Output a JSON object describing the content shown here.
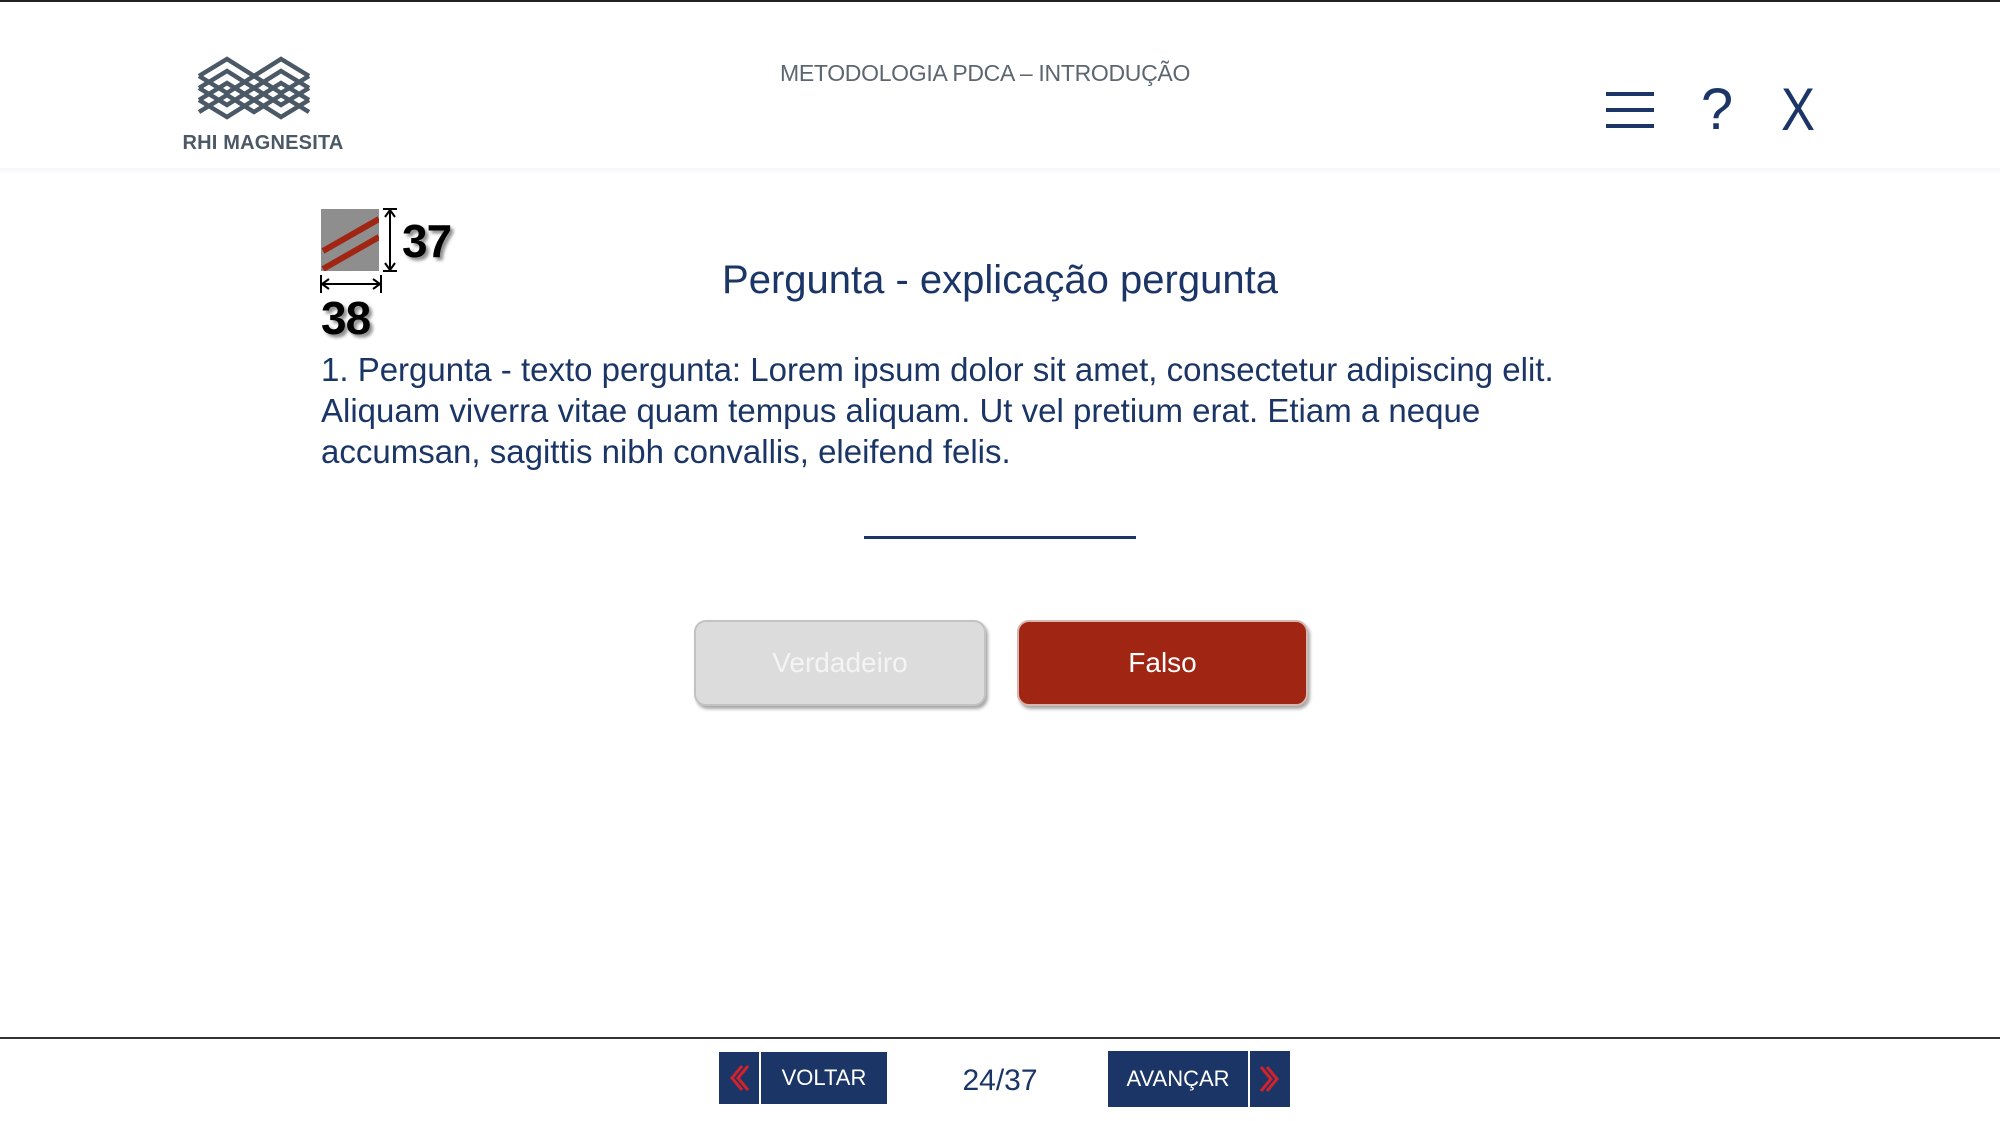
{
  "header": {
    "logo_text": "RHI MAGNESITA",
    "module_title": "METODOLOGIA PDCA – INTRODUÇÃO",
    "menu_icon": "hamburger-menu-icon",
    "help_label": "?",
    "close_label": "X"
  },
  "annotation": {
    "height_label": "37",
    "width_label": "38"
  },
  "question": {
    "heading": "Pergunta - explicação pergunta",
    "lines": [
      "1. Pergunta - texto pergunta: Lorem ipsum dolor sit amet, consectetur adipiscing elit.",
      "Aliquam viverra vitae quam tempus aliquam. Ut vel pretium erat. Etiam a neque",
      "accumsan, sagittis nibh convallis, eleifend felis."
    ]
  },
  "answers": {
    "true_label": "Verdadeiro",
    "false_label": "Falso"
  },
  "footer": {
    "back_label": "VOLTAR",
    "next_label": "AVANÇAR",
    "page_counter": "24/37"
  },
  "colors": {
    "navy": "#1a3566",
    "accent_red": "#a12513",
    "chevron_red": "#d2222b",
    "disabled_gray": "#dcdcdc"
  }
}
